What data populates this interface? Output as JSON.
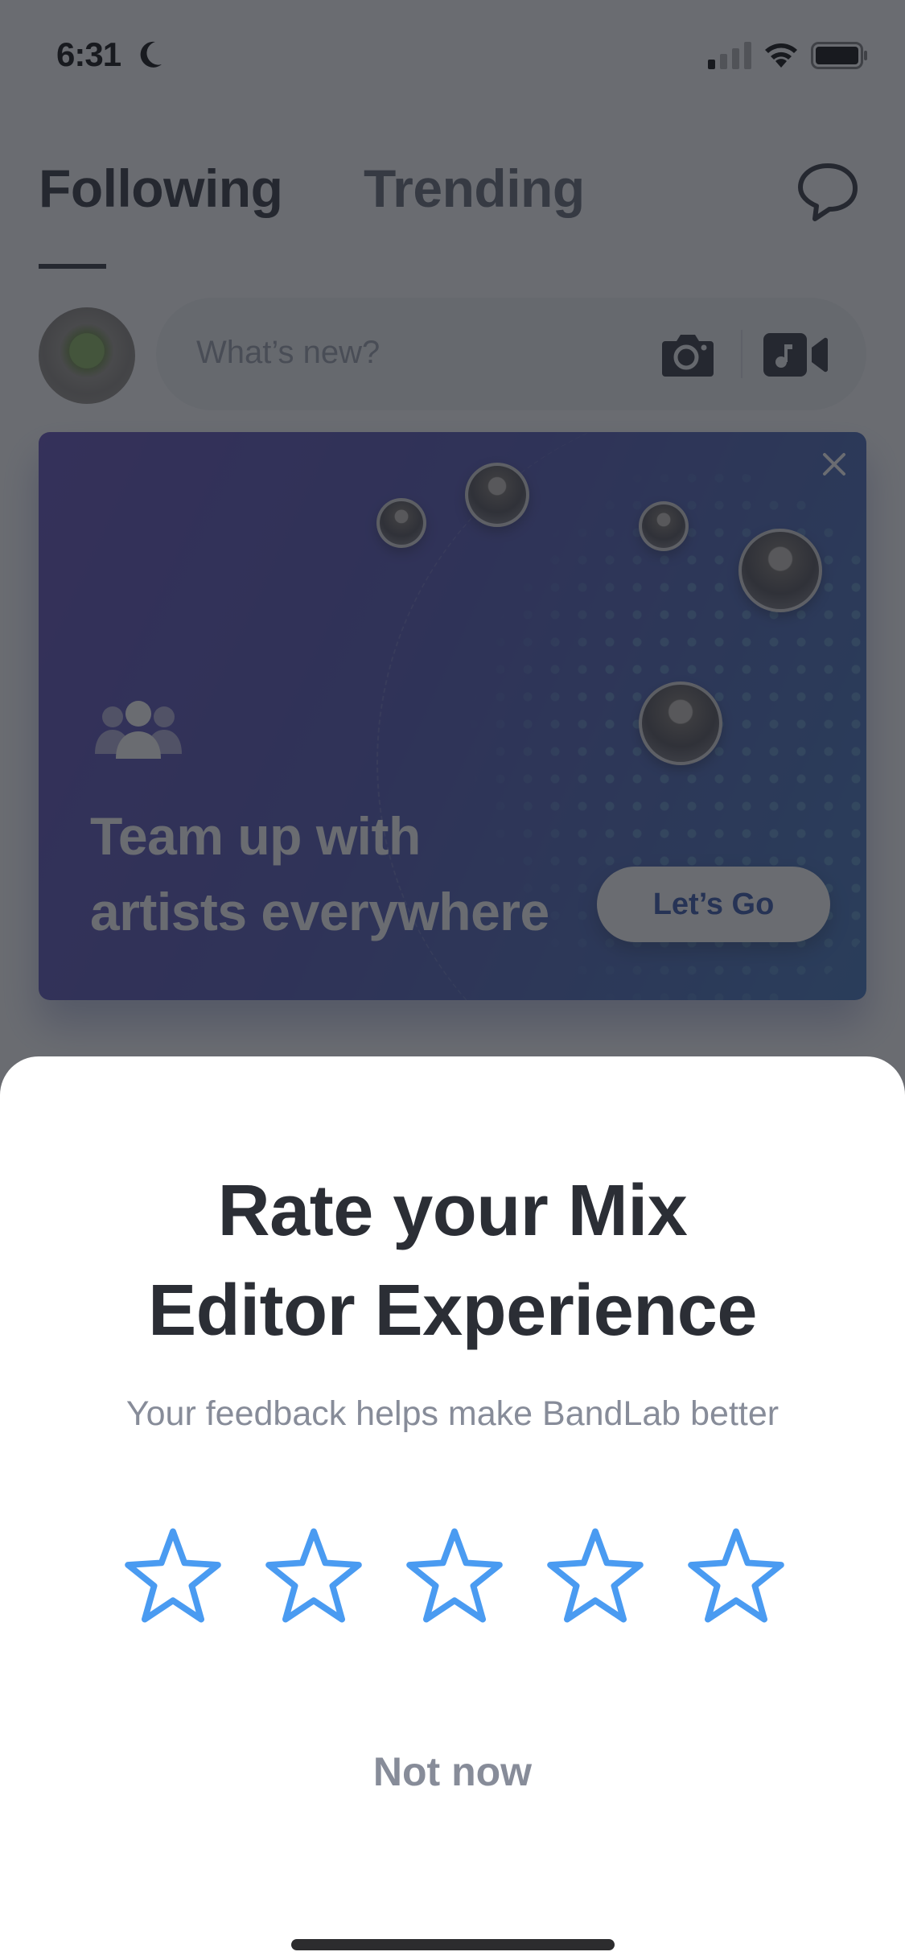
{
  "status_bar": {
    "time": "6:31",
    "focus_icon": "moon-icon",
    "signal_icon": "cellular-signal-icon",
    "wifi_icon": "wifi-icon",
    "battery_icon": "battery-icon"
  },
  "feed_header": {
    "tabs": [
      {
        "label": "Following",
        "active": true
      },
      {
        "label": "Trending",
        "active": false
      }
    ],
    "messages_icon": "chat-bubble-icon"
  },
  "composer": {
    "placeholder": "What’s new?",
    "avatar": "user-avatar-green-apple",
    "actions": [
      "camera-icon",
      "music-video-icon"
    ]
  },
  "promo_card": {
    "icon": "group-icon",
    "headline_line1": "Team up with",
    "headline_line2": "artists everywhere",
    "cta_label": "Let’s Go",
    "close_icon": "close-icon",
    "artist_bubbles": 5,
    "colors": {
      "gradient_start": "#5a47b6",
      "gradient_end": "#3a6fba",
      "cta_text": "#2d4fa8"
    }
  },
  "rating_sheet": {
    "title_line1": "Rate your Mix",
    "title_line2": "Editor Experience",
    "subtitle": "Your feedback helps make BandLab better",
    "stars_total": 5,
    "stars_selected": 0,
    "dismiss_label": "Not now",
    "colors": {
      "star": "#4a9bf1",
      "title": "#2b2e35",
      "subtitle": "#878c99"
    }
  }
}
